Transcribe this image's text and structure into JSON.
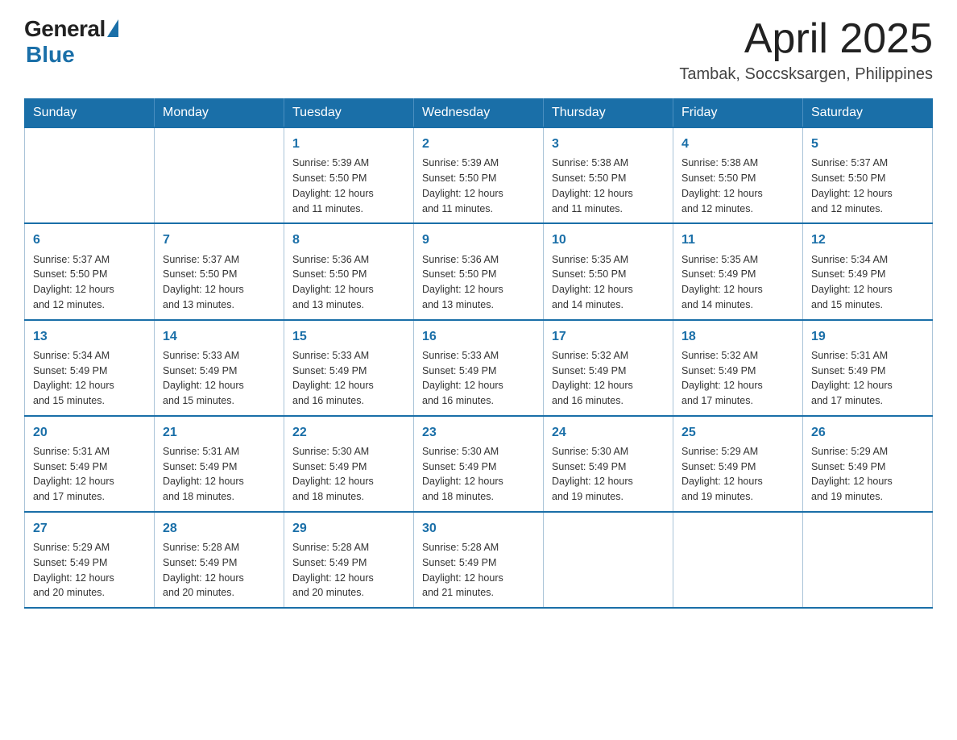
{
  "header": {
    "logo_general": "General",
    "logo_blue": "Blue",
    "month_title": "April 2025",
    "location": "Tambak, Soccsksargen, Philippines"
  },
  "weekdays": [
    "Sunday",
    "Monday",
    "Tuesday",
    "Wednesday",
    "Thursday",
    "Friday",
    "Saturday"
  ],
  "weeks": [
    [
      {
        "day": "",
        "info": ""
      },
      {
        "day": "",
        "info": ""
      },
      {
        "day": "1",
        "info": "Sunrise: 5:39 AM\nSunset: 5:50 PM\nDaylight: 12 hours\nand 11 minutes."
      },
      {
        "day": "2",
        "info": "Sunrise: 5:39 AM\nSunset: 5:50 PM\nDaylight: 12 hours\nand 11 minutes."
      },
      {
        "day": "3",
        "info": "Sunrise: 5:38 AM\nSunset: 5:50 PM\nDaylight: 12 hours\nand 11 minutes."
      },
      {
        "day": "4",
        "info": "Sunrise: 5:38 AM\nSunset: 5:50 PM\nDaylight: 12 hours\nand 12 minutes."
      },
      {
        "day": "5",
        "info": "Sunrise: 5:37 AM\nSunset: 5:50 PM\nDaylight: 12 hours\nand 12 minutes."
      }
    ],
    [
      {
        "day": "6",
        "info": "Sunrise: 5:37 AM\nSunset: 5:50 PM\nDaylight: 12 hours\nand 12 minutes."
      },
      {
        "day": "7",
        "info": "Sunrise: 5:37 AM\nSunset: 5:50 PM\nDaylight: 12 hours\nand 13 minutes."
      },
      {
        "day": "8",
        "info": "Sunrise: 5:36 AM\nSunset: 5:50 PM\nDaylight: 12 hours\nand 13 minutes."
      },
      {
        "day": "9",
        "info": "Sunrise: 5:36 AM\nSunset: 5:50 PM\nDaylight: 12 hours\nand 13 minutes."
      },
      {
        "day": "10",
        "info": "Sunrise: 5:35 AM\nSunset: 5:50 PM\nDaylight: 12 hours\nand 14 minutes."
      },
      {
        "day": "11",
        "info": "Sunrise: 5:35 AM\nSunset: 5:49 PM\nDaylight: 12 hours\nand 14 minutes."
      },
      {
        "day": "12",
        "info": "Sunrise: 5:34 AM\nSunset: 5:49 PM\nDaylight: 12 hours\nand 15 minutes."
      }
    ],
    [
      {
        "day": "13",
        "info": "Sunrise: 5:34 AM\nSunset: 5:49 PM\nDaylight: 12 hours\nand 15 minutes."
      },
      {
        "day": "14",
        "info": "Sunrise: 5:33 AM\nSunset: 5:49 PM\nDaylight: 12 hours\nand 15 minutes."
      },
      {
        "day": "15",
        "info": "Sunrise: 5:33 AM\nSunset: 5:49 PM\nDaylight: 12 hours\nand 16 minutes."
      },
      {
        "day": "16",
        "info": "Sunrise: 5:33 AM\nSunset: 5:49 PM\nDaylight: 12 hours\nand 16 minutes."
      },
      {
        "day": "17",
        "info": "Sunrise: 5:32 AM\nSunset: 5:49 PM\nDaylight: 12 hours\nand 16 minutes."
      },
      {
        "day": "18",
        "info": "Sunrise: 5:32 AM\nSunset: 5:49 PM\nDaylight: 12 hours\nand 17 minutes."
      },
      {
        "day": "19",
        "info": "Sunrise: 5:31 AM\nSunset: 5:49 PM\nDaylight: 12 hours\nand 17 minutes."
      }
    ],
    [
      {
        "day": "20",
        "info": "Sunrise: 5:31 AM\nSunset: 5:49 PM\nDaylight: 12 hours\nand 17 minutes."
      },
      {
        "day": "21",
        "info": "Sunrise: 5:31 AM\nSunset: 5:49 PM\nDaylight: 12 hours\nand 18 minutes."
      },
      {
        "day": "22",
        "info": "Sunrise: 5:30 AM\nSunset: 5:49 PM\nDaylight: 12 hours\nand 18 minutes."
      },
      {
        "day": "23",
        "info": "Sunrise: 5:30 AM\nSunset: 5:49 PM\nDaylight: 12 hours\nand 18 minutes."
      },
      {
        "day": "24",
        "info": "Sunrise: 5:30 AM\nSunset: 5:49 PM\nDaylight: 12 hours\nand 19 minutes."
      },
      {
        "day": "25",
        "info": "Sunrise: 5:29 AM\nSunset: 5:49 PM\nDaylight: 12 hours\nand 19 minutes."
      },
      {
        "day": "26",
        "info": "Sunrise: 5:29 AM\nSunset: 5:49 PM\nDaylight: 12 hours\nand 19 minutes."
      }
    ],
    [
      {
        "day": "27",
        "info": "Sunrise: 5:29 AM\nSunset: 5:49 PM\nDaylight: 12 hours\nand 20 minutes."
      },
      {
        "day": "28",
        "info": "Sunrise: 5:28 AM\nSunset: 5:49 PM\nDaylight: 12 hours\nand 20 minutes."
      },
      {
        "day": "29",
        "info": "Sunrise: 5:28 AM\nSunset: 5:49 PM\nDaylight: 12 hours\nand 20 minutes."
      },
      {
        "day": "30",
        "info": "Sunrise: 5:28 AM\nSunset: 5:49 PM\nDaylight: 12 hours\nand 21 minutes."
      },
      {
        "day": "",
        "info": ""
      },
      {
        "day": "",
        "info": ""
      },
      {
        "day": "",
        "info": ""
      }
    ]
  ]
}
